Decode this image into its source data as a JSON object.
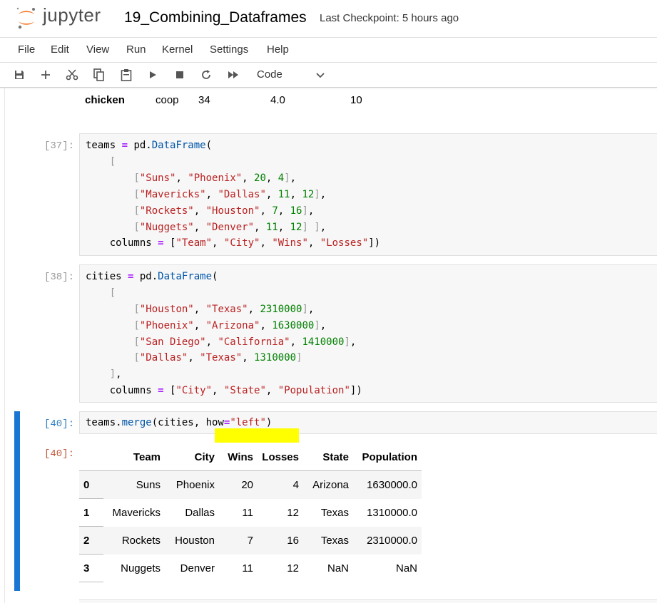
{
  "app": {
    "logo_text": "jupyter",
    "notebook_title": "19_Combining_Dataframes",
    "checkpoint": "Last Checkpoint: 5 hours ago"
  },
  "menu": [
    "File",
    "Edit",
    "View",
    "Run",
    "Kernel",
    "Settings",
    "Help"
  ],
  "toolbar": {
    "icons": [
      "save-icon",
      "add-cell-icon",
      "cut-icon",
      "copy-icon",
      "paste-icon",
      "run-icon",
      "stop-icon",
      "restart-icon",
      "run-all-icon"
    ],
    "cell_type": "Code"
  },
  "prev_output_row": {
    "index": "chicken",
    "values": [
      "coop",
      "34",
      "4.0",
      "10"
    ]
  },
  "cells": {
    "c37": {
      "prompt": "[37]:",
      "lines": [
        "teams = pd.DataFrame(",
        "    [",
        "        [\"Suns\", \"Phoenix\", 20, 4],",
        "        [\"Mavericks\", \"Dallas\", 11, 12],",
        "        [\"Rockets\", \"Houston\", 7, 16],",
        "        [\"Nuggets\", \"Denver\", 11, 12] ],",
        "    columns = [\"Team\", \"City\", \"Wins\", \"Losses\"])"
      ]
    },
    "c38": {
      "prompt": "[38]:",
      "lines": [
        "cities = pd.DataFrame(",
        "    [",
        "        [\"Houston\", \"Texas\", 2310000],",
        "        [\"Phoenix\", \"Arizona\", 1630000],",
        "        [\"San Diego\", \"California\", 1410000],",
        "        [\"Dallas\", \"Texas\", 1310000]",
        "    ],",
        "    columns = [\"City\", \"State\", \"Population\"])"
      ]
    },
    "c40": {
      "prompt_in": "[40]:",
      "prompt_out": "[40]:",
      "code": "teams.merge(cities, how=\"left\")"
    }
  },
  "result_table": {
    "columns": [
      "",
      "Team",
      "City",
      "Wins",
      "Losses",
      "State",
      "Population"
    ],
    "rows": [
      [
        "0",
        "Suns",
        "Phoenix",
        "20",
        "4",
        "Arizona",
        "1630000.0"
      ],
      [
        "1",
        "Mavericks",
        "Dallas",
        "11",
        "12",
        "Texas",
        "1310000.0"
      ],
      [
        "2",
        "Rockets",
        "Houston",
        "7",
        "16",
        "Texas",
        "2310000.0"
      ],
      [
        "3",
        "Nuggets",
        "Denver",
        "11",
        "12",
        "NaN",
        "NaN"
      ]
    ]
  },
  "colors": {
    "selection_bar": "#1976d2",
    "highlight": "#ffff00",
    "logo_orange": "#f37726"
  }
}
